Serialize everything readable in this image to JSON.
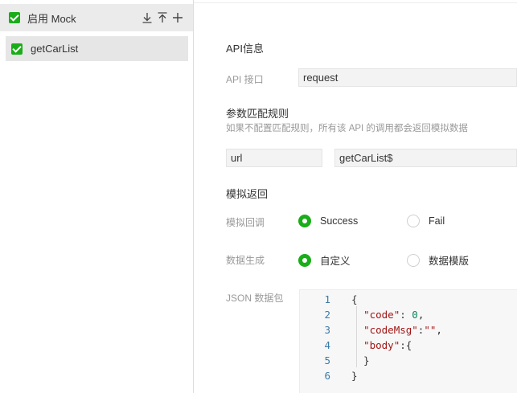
{
  "sidebar": {
    "enable_label": "启用 Mock",
    "tools": [
      "download-icon",
      "upload-icon",
      "add-icon"
    ],
    "items": [
      {
        "label": "getCarList",
        "checked": true
      }
    ]
  },
  "main": {
    "api_info_title": "API信息",
    "api_label": "API 接口",
    "api_value": "request",
    "match_title": "参数匹配规则",
    "match_hint": "如果不配置匹配规则，所有该 API 的调用都会返回模拟数据",
    "match_key": "url",
    "match_value": "getCarList$",
    "return_title": "模拟返回",
    "callback_label": "模拟回调",
    "callback_options": [
      {
        "label": "Success",
        "selected": true
      },
      {
        "label": "Fail",
        "selected": false
      }
    ],
    "generate_label": "数据生成",
    "generate_options": [
      {
        "label": "自定义",
        "selected": true
      },
      {
        "label": "数据模版",
        "selected": false
      }
    ],
    "json_label": "JSON 数据包",
    "json_lines": [
      {
        "no": "1",
        "text": "{"
      },
      {
        "no": "2",
        "key": "\"code\"",
        "sep": ": ",
        "val": "0",
        "tail": ","
      },
      {
        "no": "3",
        "key": "\"codeMsg\"",
        "sep": ":",
        "val": "\"\"",
        "tail": ","
      },
      {
        "no": "4",
        "key": "\"body\"",
        "sep": ":",
        "val": "",
        "tail": "{"
      },
      {
        "no": "5",
        "text": "  }"
      },
      {
        "no": "6",
        "text": "}"
      }
    ]
  },
  "colors": {
    "accent": "#1aad19",
    "line_number": "#3d7aa8"
  }
}
